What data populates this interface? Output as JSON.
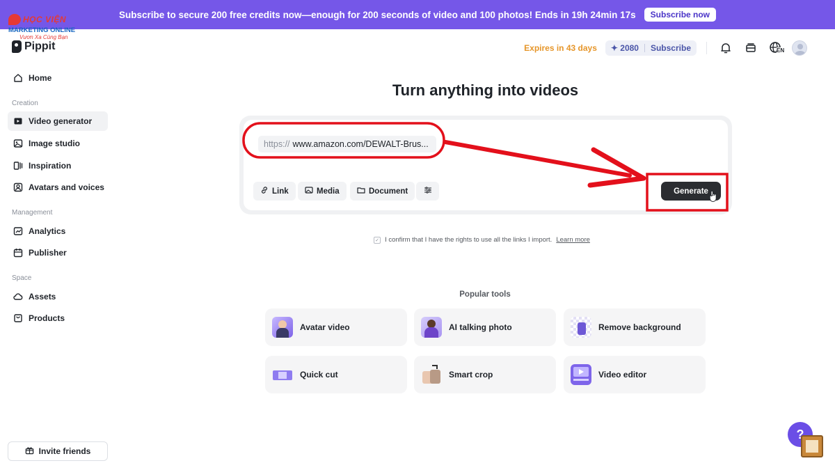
{
  "banner": {
    "text": "Subscribe to secure 200 free credits now—enough for 200 seconds of video and 100 photos! Ends in 19h 24min 17s",
    "button": "Subscribe now"
  },
  "watermark": {
    "line1": "HỌC VIỆN",
    "line2": "MARKETING ONLINE",
    "line3": "Vươn Xa Cùng Bạn"
  },
  "brand": {
    "name": "Pippit"
  },
  "topbar": {
    "expires": "Expires in 43 days",
    "credits": "✦ 2080",
    "subscribe": "Subscribe",
    "language": "EN",
    "icons": [
      "bell-icon",
      "inbox-icon",
      "globe-icon",
      "avatar"
    ]
  },
  "sidebar": {
    "home": "Home",
    "section_creation": "Creation",
    "video_generator": "Video generator",
    "image_studio": "Image studio",
    "inspiration": "Inspiration",
    "avatars_voices": "Avatars and voices",
    "section_management": "Management",
    "analytics": "Analytics",
    "publisher": "Publisher",
    "section_space": "Space",
    "assets": "Assets",
    "products": "Products",
    "invite": "Invite friends"
  },
  "main": {
    "title": "Turn anything into videos",
    "url_prefix": "https://",
    "url_value": "www.amazon.com/DEWALT-Brus...",
    "link": "Link",
    "media": "Media",
    "document": "Document",
    "generate": "Generate",
    "confirm_text": "I confirm that I have the rights to use all the links I import.",
    "learn_more": "Learn more",
    "popular_title": "Popular tools",
    "tools": [
      "Avatar video",
      "AI talking photo",
      "Remove background",
      "Quick cut",
      "Smart crop",
      "Video editor"
    ]
  },
  "help": {
    "label": "?"
  },
  "colors": {
    "accent": "#7557e8",
    "annotation": "#e3101b",
    "generate_bg": "#2b2d31",
    "expires": "#e6962a"
  }
}
